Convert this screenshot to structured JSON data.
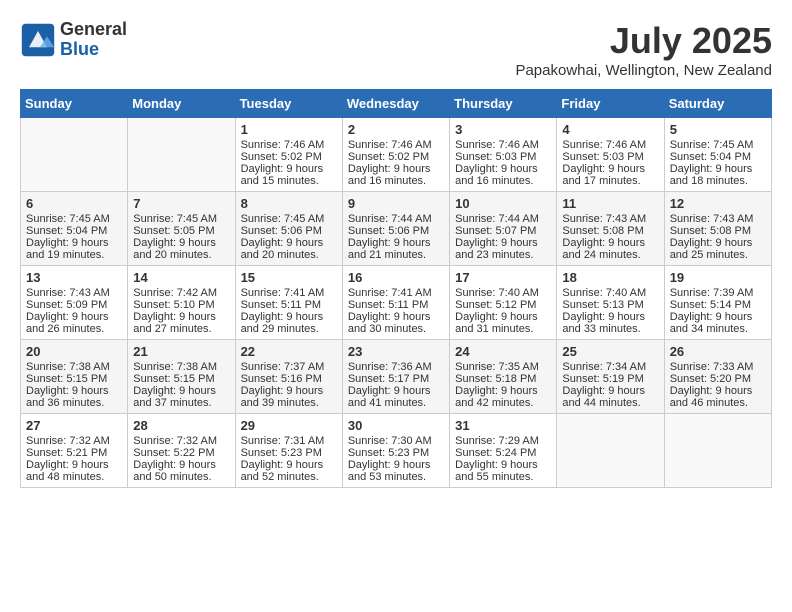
{
  "logo": {
    "general": "General",
    "blue": "Blue"
  },
  "title": {
    "month_year": "July 2025",
    "location": "Papakowhai, Wellington, New Zealand"
  },
  "days_of_week": [
    "Sunday",
    "Monday",
    "Tuesday",
    "Wednesday",
    "Thursday",
    "Friday",
    "Saturday"
  ],
  "weeks": [
    [
      {
        "day": "",
        "sunrise": "",
        "sunset": "",
        "daylight": ""
      },
      {
        "day": "",
        "sunrise": "",
        "sunset": "",
        "daylight": ""
      },
      {
        "day": "1",
        "sunrise": "Sunrise: 7:46 AM",
        "sunset": "Sunset: 5:02 PM",
        "daylight": "Daylight: 9 hours and 15 minutes."
      },
      {
        "day": "2",
        "sunrise": "Sunrise: 7:46 AM",
        "sunset": "Sunset: 5:02 PM",
        "daylight": "Daylight: 9 hours and 16 minutes."
      },
      {
        "day": "3",
        "sunrise": "Sunrise: 7:46 AM",
        "sunset": "Sunset: 5:03 PM",
        "daylight": "Daylight: 9 hours and 16 minutes."
      },
      {
        "day": "4",
        "sunrise": "Sunrise: 7:46 AM",
        "sunset": "Sunset: 5:03 PM",
        "daylight": "Daylight: 9 hours and 17 minutes."
      },
      {
        "day": "5",
        "sunrise": "Sunrise: 7:45 AM",
        "sunset": "Sunset: 5:04 PM",
        "daylight": "Daylight: 9 hours and 18 minutes."
      }
    ],
    [
      {
        "day": "6",
        "sunrise": "Sunrise: 7:45 AM",
        "sunset": "Sunset: 5:04 PM",
        "daylight": "Daylight: 9 hours and 19 minutes."
      },
      {
        "day": "7",
        "sunrise": "Sunrise: 7:45 AM",
        "sunset": "Sunset: 5:05 PM",
        "daylight": "Daylight: 9 hours and 20 minutes."
      },
      {
        "day": "8",
        "sunrise": "Sunrise: 7:45 AM",
        "sunset": "Sunset: 5:06 PM",
        "daylight": "Daylight: 9 hours and 20 minutes."
      },
      {
        "day": "9",
        "sunrise": "Sunrise: 7:44 AM",
        "sunset": "Sunset: 5:06 PM",
        "daylight": "Daylight: 9 hours and 21 minutes."
      },
      {
        "day": "10",
        "sunrise": "Sunrise: 7:44 AM",
        "sunset": "Sunset: 5:07 PM",
        "daylight": "Daylight: 9 hours and 23 minutes."
      },
      {
        "day": "11",
        "sunrise": "Sunrise: 7:43 AM",
        "sunset": "Sunset: 5:08 PM",
        "daylight": "Daylight: 9 hours and 24 minutes."
      },
      {
        "day": "12",
        "sunrise": "Sunrise: 7:43 AM",
        "sunset": "Sunset: 5:08 PM",
        "daylight": "Daylight: 9 hours and 25 minutes."
      }
    ],
    [
      {
        "day": "13",
        "sunrise": "Sunrise: 7:43 AM",
        "sunset": "Sunset: 5:09 PM",
        "daylight": "Daylight: 9 hours and 26 minutes."
      },
      {
        "day": "14",
        "sunrise": "Sunrise: 7:42 AM",
        "sunset": "Sunset: 5:10 PM",
        "daylight": "Daylight: 9 hours and 27 minutes."
      },
      {
        "day": "15",
        "sunrise": "Sunrise: 7:41 AM",
        "sunset": "Sunset: 5:11 PM",
        "daylight": "Daylight: 9 hours and 29 minutes."
      },
      {
        "day": "16",
        "sunrise": "Sunrise: 7:41 AM",
        "sunset": "Sunset: 5:11 PM",
        "daylight": "Daylight: 9 hours and 30 minutes."
      },
      {
        "day": "17",
        "sunrise": "Sunrise: 7:40 AM",
        "sunset": "Sunset: 5:12 PM",
        "daylight": "Daylight: 9 hours and 31 minutes."
      },
      {
        "day": "18",
        "sunrise": "Sunrise: 7:40 AM",
        "sunset": "Sunset: 5:13 PM",
        "daylight": "Daylight: 9 hours and 33 minutes."
      },
      {
        "day": "19",
        "sunrise": "Sunrise: 7:39 AM",
        "sunset": "Sunset: 5:14 PM",
        "daylight": "Daylight: 9 hours and 34 minutes."
      }
    ],
    [
      {
        "day": "20",
        "sunrise": "Sunrise: 7:38 AM",
        "sunset": "Sunset: 5:15 PM",
        "daylight": "Daylight: 9 hours and 36 minutes."
      },
      {
        "day": "21",
        "sunrise": "Sunrise: 7:38 AM",
        "sunset": "Sunset: 5:15 PM",
        "daylight": "Daylight: 9 hours and 37 minutes."
      },
      {
        "day": "22",
        "sunrise": "Sunrise: 7:37 AM",
        "sunset": "Sunset: 5:16 PM",
        "daylight": "Daylight: 9 hours and 39 minutes."
      },
      {
        "day": "23",
        "sunrise": "Sunrise: 7:36 AM",
        "sunset": "Sunset: 5:17 PM",
        "daylight": "Daylight: 9 hours and 41 minutes."
      },
      {
        "day": "24",
        "sunrise": "Sunrise: 7:35 AM",
        "sunset": "Sunset: 5:18 PM",
        "daylight": "Daylight: 9 hours and 42 minutes."
      },
      {
        "day": "25",
        "sunrise": "Sunrise: 7:34 AM",
        "sunset": "Sunset: 5:19 PM",
        "daylight": "Daylight: 9 hours and 44 minutes."
      },
      {
        "day": "26",
        "sunrise": "Sunrise: 7:33 AM",
        "sunset": "Sunset: 5:20 PM",
        "daylight": "Daylight: 9 hours and 46 minutes."
      }
    ],
    [
      {
        "day": "27",
        "sunrise": "Sunrise: 7:32 AM",
        "sunset": "Sunset: 5:21 PM",
        "daylight": "Daylight: 9 hours and 48 minutes."
      },
      {
        "day": "28",
        "sunrise": "Sunrise: 7:32 AM",
        "sunset": "Sunset: 5:22 PM",
        "daylight": "Daylight: 9 hours and 50 minutes."
      },
      {
        "day": "29",
        "sunrise": "Sunrise: 7:31 AM",
        "sunset": "Sunset: 5:23 PM",
        "daylight": "Daylight: 9 hours and 52 minutes."
      },
      {
        "day": "30",
        "sunrise": "Sunrise: 7:30 AM",
        "sunset": "Sunset: 5:23 PM",
        "daylight": "Daylight: 9 hours and 53 minutes."
      },
      {
        "day": "31",
        "sunrise": "Sunrise: 7:29 AM",
        "sunset": "Sunset: 5:24 PM",
        "daylight": "Daylight: 9 hours and 55 minutes."
      },
      {
        "day": "",
        "sunrise": "",
        "sunset": "",
        "daylight": ""
      },
      {
        "day": "",
        "sunrise": "",
        "sunset": "",
        "daylight": ""
      }
    ]
  ]
}
